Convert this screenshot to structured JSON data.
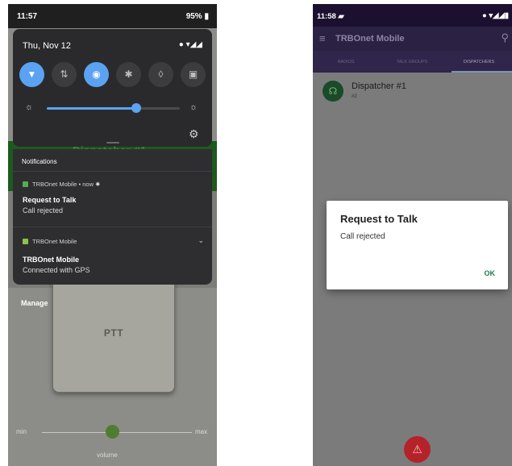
{
  "left_phone": {
    "status_bar": {
      "time": "11:57",
      "battery": "95%"
    },
    "quick_settings": {
      "date": "Thu, Nov 12",
      "system_icons": "● ▾◢◢",
      "tiles": [
        {
          "icon": "wifi-icon",
          "glyph": "▼",
          "active": true
        },
        {
          "icon": "data-icon",
          "glyph": "⇅",
          "active": false
        },
        {
          "icon": "location-icon",
          "glyph": "◉",
          "active": true
        },
        {
          "icon": "bluetooth-icon",
          "glyph": "✱",
          "active": false
        },
        {
          "icon": "flashlight-icon",
          "glyph": "◊",
          "active": false
        },
        {
          "icon": "nfc-icon",
          "glyph": "▣",
          "active": false
        }
      ],
      "brightness_level": 0.67,
      "brightness_low_glyph": "☼",
      "brightness_high_glyph": "☼",
      "settings_glyph": "⚙"
    },
    "background_ghost_title": "Dispatcher #1",
    "notifications": {
      "title": "Notifications",
      "items": [
        {
          "app": "TRBOnet Mobile • now",
          "extra_glyph": "✸",
          "heading": "Request to Talk",
          "body": "Call rejected",
          "dot_color": "#4caf50"
        },
        {
          "app": "TRBOnet Mobile",
          "heading": "TRBOnet Mobile",
          "body": "Connected with GPS",
          "dot_color": "#8bc34a",
          "chevron": "⌄"
        }
      ]
    },
    "manage": "Manage",
    "ptt_label": "PTT",
    "volume": {
      "min": "min",
      "max": "max",
      "caption": "volume",
      "level": 0.48
    }
  },
  "right_phone": {
    "status_bar": {
      "time": "11:58",
      "notif_glyph": "▰",
      "icons": "● ▾◢◢▮"
    },
    "app_bar": {
      "menu_glyph": "≡",
      "title": "TRBOnet Mobile",
      "search_glyph": "⚲"
    },
    "tabs": [
      "RADIOS",
      "TALK GROUPS",
      "DISPATCHERS"
    ],
    "active_tab": "DISPATCHERS",
    "dispatcher": {
      "name": "Dispatcher #1",
      "sub": "#2",
      "avatar_glyph": "☊"
    },
    "dialog": {
      "title": "Request to Talk",
      "message": "Call rejected",
      "ok": "OK"
    },
    "fab_glyph": "⚠"
  }
}
